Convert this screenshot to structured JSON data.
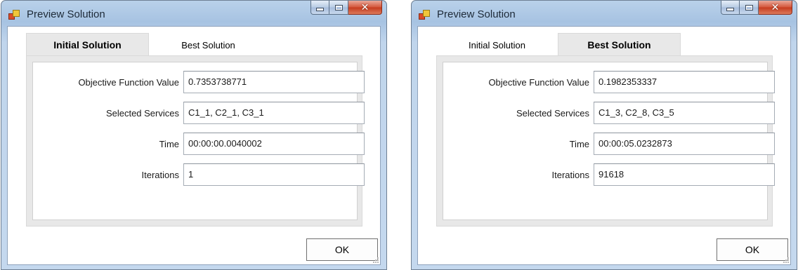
{
  "windows": [
    {
      "title": "Preview Solution",
      "tabs": [
        {
          "label": "Initial Solution",
          "active": true
        },
        {
          "label": "Best Solution",
          "active": false
        }
      ],
      "fields": [
        {
          "label": "Objective Function Value",
          "value": "0.7353738771"
        },
        {
          "label": "Selected Services",
          "value": "C1_1, C2_1, C3_1"
        },
        {
          "label": "Time",
          "value": "00:00:00.0040002"
        },
        {
          "label": "Iterations",
          "value": "1"
        }
      ],
      "ok_label": "OK"
    },
    {
      "title": "Preview Solution",
      "tabs": [
        {
          "label": "Initial Solution",
          "active": false
        },
        {
          "label": "Best Solution",
          "active": true
        }
      ],
      "fields": [
        {
          "label": "Objective Function Value",
          "value": "0.1982353337"
        },
        {
          "label": "Selected Services",
          "value": "C1_3, C2_8, C3_5"
        },
        {
          "label": "Time",
          "value": "00:00:05.0232873"
        },
        {
          "label": "Iterations",
          "value": "91618"
        }
      ],
      "ok_label": "OK"
    }
  ],
  "window_controls": {
    "minimize": "minimize-icon",
    "maximize": "maximize-icon",
    "close": "close-icon"
  },
  "icons": {
    "app": "app-window-icon"
  }
}
